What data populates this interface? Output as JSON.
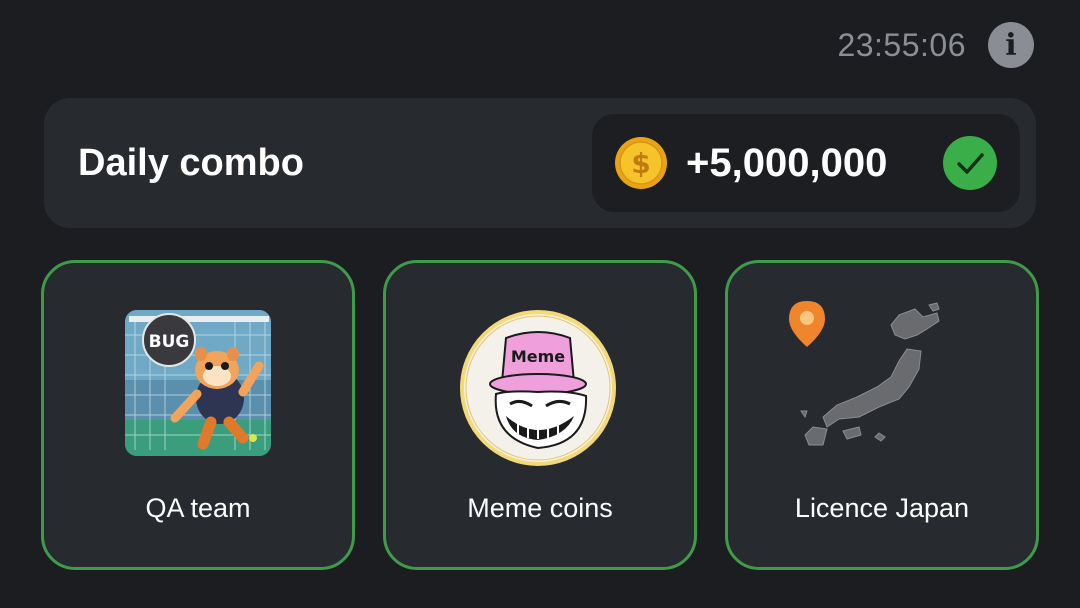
{
  "header": {
    "timer": "23:55:06",
    "info_icon": "info-icon",
    "info_glyph": "i"
  },
  "combo": {
    "title": "Daily combo",
    "reward": "+5,000,000",
    "coin_icon": "coin-icon",
    "status_icon": "checkmark-icon",
    "status": "completed"
  },
  "cards": [
    {
      "label": "QA team",
      "image": "hamster-goalkeeper-image",
      "image_text": "BUG"
    },
    {
      "label": "Meme coins",
      "image": "troll-face-image",
      "image_text": "Meme"
    },
    {
      "label": "Licence Japan",
      "image": "japan-map-image",
      "pin_icon": "location-pin-icon"
    }
  ],
  "colors": {
    "background": "#1b1d21",
    "panel": "#272a2f",
    "card_border": "#3f9a4a",
    "check_green": "#3aae48",
    "coin_gold": "#f2b81c",
    "timer_gray": "#8b8e94"
  }
}
